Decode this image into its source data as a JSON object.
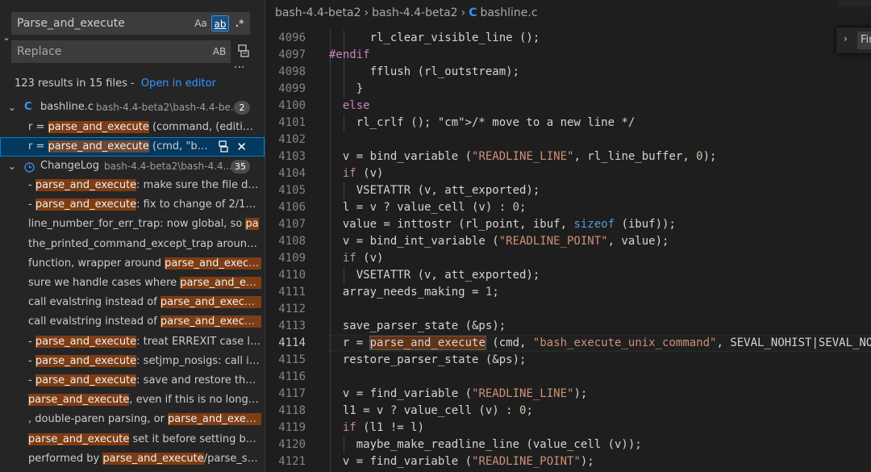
{
  "search": {
    "query": "Parse_and_execute",
    "replace_placeholder": "Replace",
    "opt_case": "Aa",
    "opt_word": "ab",
    "opt_regex": ".*",
    "opt_preserve_case": "AB",
    "more": "···"
  },
  "summary": {
    "text": "123 results in 15 files - ",
    "link": "Open in editor"
  },
  "files": [
    {
      "icon": "C",
      "name": "bashline.c",
      "path": "bash-4.4-beta2\\bash-4.4-be...",
      "count": "2"
    },
    {
      "icon": "clock",
      "name": "ChangeLog",
      "path": "bash-4.4-beta2\\bash-4.4...",
      "count": "35"
    }
  ],
  "matches_file1": [
    {
      "pre": "r = ",
      "hit": "parse_and_execute",
      "post": " (command, (editing_..."
    },
    {
      "pre": "r = ",
      "hit": "parse_and_execute",
      "post": " (cmd, \"ba..."
    }
  ],
  "matches_file2": [
    {
      "pre": "- ",
      "hit": "parse_and_execute",
      "post": ": make sure the file des..."
    },
    {
      "pre": "- ",
      "hit": "parse_and_execute",
      "post": ": fix to change of 2/18: ..."
    },
    {
      "pre": "line_number_for_err_trap: now global, so ",
      "hit": "pa",
      "post": ""
    },
    {
      "pre": "the_printed_command_except_trap around ...",
      "hit": "",
      "post": ""
    },
    {
      "pre": "function, wrapper around ",
      "hit": "parse_and_execute",
      "post": "."
    },
    {
      "pre": "sure we handle cases where ",
      "hit": "parse_and_exe...",
      "post": ""
    },
    {
      "pre": "call evalstring instead of ",
      "hit": "parse_and_execute",
      "post": "."
    },
    {
      "pre": "call evalstring instead of ",
      "hit": "parse_and_execute",
      "post": ""
    },
    {
      "pre": "- ",
      "hit": "parse_and_execute",
      "post": ": treat ERREXIT case like..."
    },
    {
      "pre": "- ",
      "hit": "parse_and_execute",
      "post": ": setjmp_nosigs: call ins..."
    },
    {
      "pre": "- ",
      "hit": "parse_and_execute",
      "post": ": save and restore the si..."
    },
    {
      "pre": "",
      "hit": "parse_and_execute",
      "post": ", even if this is no longer ..."
    },
    {
      "pre": ", double-paren parsing, or ",
      "hit": "parse_and_execute",
      "post": ""
    },
    {
      "pre": "",
      "hit": "parse_and_execute",
      "post": " set it before setting bas..."
    },
    {
      "pre": "performed by ",
      "hit": "parse_and_execute",
      "post": "/parse_stri..."
    }
  ],
  "breadcrumb": [
    "bash-4.4-beta2",
    "bash-4.4-beta2",
    "bashline.c"
  ],
  "find_widget": {
    "text": "Fir"
  },
  "line_numbers": [
    "4096",
    "4097",
    "4098",
    "4099",
    "4100",
    "4101",
    "4102",
    "4103",
    "4104",
    "4105",
    "4106",
    "4107",
    "4108",
    "4109",
    "4110",
    "4111",
    "4112",
    "4113",
    "4114",
    "4115",
    "4116",
    "4117",
    "4118",
    "4119",
    "4120",
    "4121"
  ],
  "current_line": "4114",
  "code_lines": [
    "      rl_clear_visible_line ();",
    "#endif",
    "      fflush (rl_outstream);",
    "    }",
    "  else",
    "    rl_crlf (); /* move to a new line */",
    "",
    "  v = bind_variable (\"READLINE_LINE\", rl_line_buffer, 0);",
    "  if (v)",
    "    VSETATTR (v, att_exported);",
    "  l = v ? value_cell (v) : 0;",
    "  value = inttostr (rl_point, ibuf, sizeof (ibuf));",
    "  v = bind_int_variable (\"READLINE_POINT\", value);",
    "  if (v)",
    "    VSETATTR (v, att_exported);",
    "  array_needs_making = 1;",
    "",
    "  save_parser_state (&ps);",
    "  r = parse_and_execute (cmd, \"bash_execute_unix_command\", SEVAL_NOHIST|SEVAL_NO",
    "  restore_parser_state (&ps);",
    "",
    "  v = find_variable (\"READLINE_LINE\");",
    "  l1 = v ? value_cell (v) : 0;",
    "  if (l1 != l)",
    "    maybe_make_readline_line (value_cell (v));",
    "  v = find_variable (\"READLINE_POINT\");"
  ],
  "colors": {
    "accent": "#3794ff",
    "match": "#ea5c00",
    "selection": "#04395e"
  }
}
